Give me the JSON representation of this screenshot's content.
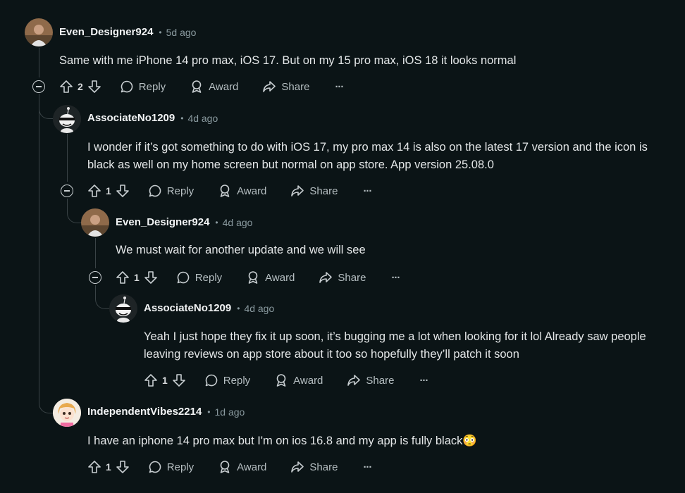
{
  "comments": [
    {
      "author": "Even_Designer924",
      "time": "5d ago",
      "text": "Same with me iPhone 14 pro max, iOS 17. But on my 15 pro max, iOS 18 it looks normal",
      "votes": "2",
      "reply": "Reply",
      "award": "Award",
      "share": "Share",
      "more": "···"
    },
    {
      "author": "AssociateNo1209",
      "time": "4d ago",
      "text": "I wonder if it’s got something to do with iOS 17, my pro max 14 is also on the latest 17 version and the icon is black as well on my home screen but normal on app store. App version 25.08.0",
      "votes": "1",
      "reply": "Reply",
      "award": "Award",
      "share": "Share",
      "more": "···"
    },
    {
      "author": "Even_Designer924",
      "time": "4d ago",
      "text": "We must wait for another update and we will see",
      "votes": "1",
      "reply": "Reply",
      "award": "Award",
      "share": "Share",
      "more": "···"
    },
    {
      "author": "AssociateNo1209",
      "time": "4d ago",
      "text": "Yeah I just hope they fix it up soon, it’s bugging me a lot when looking for it lol Already saw people leaving reviews on app store about it too so hopefully they’ll patch it soon",
      "votes": "1",
      "reply": "Reply",
      "award": "Award",
      "share": "Share",
      "more": "···"
    },
    {
      "author": "IndependentVibes2214",
      "time": "1d ago",
      "text": "I have an iphone 14 pro max but I'm on ios 16.8 and my app is fully black😳",
      "votes": "1",
      "reply": "Reply",
      "award": "Award",
      "share": "Share",
      "more": "···"
    }
  ],
  "colors": {
    "background": "#0b1416",
    "thread_line": "#3a4346",
    "text": "#e4e7e8",
    "meta": "#8a9a9f"
  }
}
